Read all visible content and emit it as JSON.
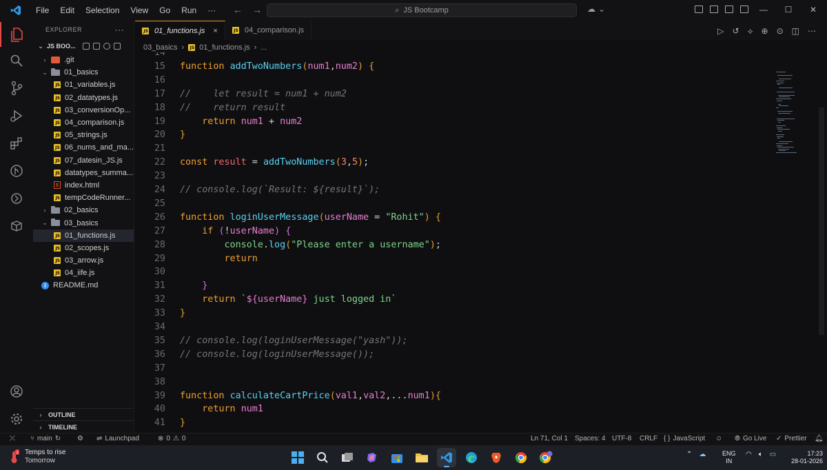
{
  "titlebar": {
    "menu": [
      "File",
      "Edit",
      "Selection",
      "View",
      "Go",
      "Run",
      "···"
    ],
    "search_text": "JS Bootcamp"
  },
  "explorer": {
    "title": "EXPLORER",
    "more": "···",
    "root": "JS BOO...",
    "tree": [
      {
        "type": "folder",
        "label": ".git",
        "depth": 1,
        "icon": "git-icon",
        "open": false
      },
      {
        "type": "folder",
        "label": "01_basics",
        "depth": 1,
        "open": true
      },
      {
        "type": "js",
        "label": "01_variables.js",
        "depth": 2
      },
      {
        "type": "js",
        "label": "02_datatypes.js",
        "depth": 2
      },
      {
        "type": "js",
        "label": "03_conversionOp...",
        "depth": 2
      },
      {
        "type": "js",
        "label": "04_comparison.js",
        "depth": 2
      },
      {
        "type": "js",
        "label": "05_strings.js",
        "depth": 2
      },
      {
        "type": "js",
        "label": "06_nums_and_ma...",
        "depth": 2
      },
      {
        "type": "js",
        "label": "07_datesin_JS.js",
        "depth": 2
      },
      {
        "type": "js",
        "label": "datatypes_summa...",
        "depth": 2
      },
      {
        "type": "html",
        "label": "index.html",
        "depth": 2
      },
      {
        "type": "js",
        "label": "tempCodeRunner...",
        "depth": 2
      },
      {
        "type": "folder",
        "label": "02_basics",
        "depth": 1,
        "open": false
      },
      {
        "type": "folder",
        "label": "03_basics",
        "depth": 1,
        "open": true
      },
      {
        "type": "js",
        "label": "01_functions.js",
        "depth": 2,
        "selected": true
      },
      {
        "type": "js",
        "label": "02_scopes.js",
        "depth": 2
      },
      {
        "type": "js",
        "label": "03_arrow.js",
        "depth": 2
      },
      {
        "type": "js",
        "label": "04_iife.js",
        "depth": 2
      },
      {
        "type": "info",
        "label": "README.md",
        "depth": 1
      }
    ],
    "outline": "OUTLINE",
    "timeline": "TIMELINE"
  },
  "tabs": [
    {
      "label": "01_functions.js",
      "close": "×",
      "active": true
    },
    {
      "label": "04_comparison.js",
      "active": false
    }
  ],
  "breadcrumb": {
    "folder": "03_basics",
    "file": "01_functions.js",
    "more": "..."
  },
  "code": [
    {
      "n": "14",
      "t": []
    },
    {
      "n": "15",
      "t": [
        [
          "kw",
          "function "
        ],
        [
          "fn",
          "addTwoNumbers"
        ],
        [
          "br",
          "("
        ],
        [
          "pm",
          "num1"
        ],
        [
          "",
          ","
        ],
        [
          "pm",
          "num2"
        ],
        [
          "br",
          ")"
        ],
        [
          "",
          " "
        ],
        [
          "br",
          "{"
        ]
      ]
    },
    {
      "n": "16",
      "t": []
    },
    {
      "n": "17",
      "t": [
        [
          "cm",
          "//    let result = num1 + num2"
        ]
      ]
    },
    {
      "n": "18",
      "t": [
        [
          "cm",
          "//    return result"
        ]
      ]
    },
    {
      "n": "19",
      "t": [
        [
          "",
          "    "
        ],
        [
          "kw",
          "return "
        ],
        [
          "pm",
          "num1"
        ],
        [
          "",
          " + "
        ],
        [
          "pm",
          "num2"
        ]
      ]
    },
    {
      "n": "20",
      "t": [
        [
          "br",
          "}"
        ]
      ]
    },
    {
      "n": "21",
      "t": []
    },
    {
      "n": "22",
      "t": [
        [
          "kw",
          "const "
        ],
        [
          "var",
          "result"
        ],
        [
          "",
          " = "
        ],
        [
          "fn",
          "addTwoNumbers"
        ],
        [
          "br",
          "("
        ],
        [
          "num",
          "3"
        ],
        [
          "",
          ","
        ],
        [
          "num",
          "5"
        ],
        [
          "br",
          ")"
        ],
        [
          "",
          ";"
        ]
      ]
    },
    {
      "n": "23",
      "t": []
    },
    {
      "n": "24",
      "t": [
        [
          "cm",
          "// console.log(`Result: ${result}`);"
        ]
      ]
    },
    {
      "n": "25",
      "t": []
    },
    {
      "n": "26",
      "t": [
        [
          "kw",
          "function "
        ],
        [
          "fn",
          "loginUserMessage"
        ],
        [
          "br",
          "("
        ],
        [
          "pm",
          "userName"
        ],
        [
          "",
          " = "
        ],
        [
          "str",
          "\"Rohit\""
        ],
        [
          "br",
          ")"
        ],
        [
          "",
          " "
        ],
        [
          "br",
          "{"
        ]
      ]
    },
    {
      "n": "27",
      "t": [
        [
          "",
          "    "
        ],
        [
          "kw",
          "if "
        ],
        [
          "br2",
          "("
        ],
        [
          "",
          "!"
        ],
        [
          "pm",
          "userName"
        ],
        [
          "br2",
          ")"
        ],
        [
          "",
          " "
        ],
        [
          "br2",
          "{"
        ]
      ]
    },
    {
      "n": "28",
      "t": [
        [
          "",
          "        "
        ],
        [
          "str",
          "console"
        ],
        [
          "",
          "."
        ],
        [
          "fn",
          "log"
        ],
        [
          "br",
          "("
        ],
        [
          "str",
          "\"Please enter a username\""
        ],
        [
          "br",
          ")"
        ],
        [
          "",
          ";"
        ]
      ]
    },
    {
      "n": "29",
      "t": [
        [
          "",
          "        "
        ],
        [
          "kw",
          "return"
        ]
      ]
    },
    {
      "n": "30",
      "t": []
    },
    {
      "n": "31",
      "t": [
        [
          "",
          "    "
        ],
        [
          "br2",
          "}"
        ]
      ]
    },
    {
      "n": "32",
      "t": [
        [
          "",
          "    "
        ],
        [
          "kw",
          "return "
        ],
        [
          "str",
          "`"
        ],
        [
          "pm",
          "${"
        ],
        [
          "pm",
          "userName"
        ],
        [
          "pm",
          "}"
        ],
        [
          "str",
          " just logged in`"
        ]
      ]
    },
    {
      "n": "33",
      "t": [
        [
          "br",
          "}"
        ]
      ]
    },
    {
      "n": "34",
      "t": []
    },
    {
      "n": "35",
      "t": [
        [
          "cm",
          "// console.log(loginUserMessage(\"yash\"));"
        ]
      ]
    },
    {
      "n": "36",
      "t": [
        [
          "cm",
          "// console.log(loginUserMessage());"
        ]
      ]
    },
    {
      "n": "37",
      "t": []
    },
    {
      "n": "38",
      "t": []
    },
    {
      "n": "39",
      "t": [
        [
          "kw",
          "function "
        ],
        [
          "fn",
          "calculateCartPrice"
        ],
        [
          "br",
          "("
        ],
        [
          "pm",
          "val1"
        ],
        [
          "",
          ","
        ],
        [
          "pm",
          "val2"
        ],
        [
          "",
          ","
        ],
        [
          "",
          "..."
        ],
        [
          "pm",
          "num1"
        ],
        [
          "br",
          ")"
        ],
        [
          "br",
          "{"
        ]
      ]
    },
    {
      "n": "40",
      "t": [
        [
          "",
          "    "
        ],
        [
          "kw",
          "return "
        ],
        [
          "pm",
          "num1"
        ]
      ]
    },
    {
      "n": "41",
      "t": [
        [
          "br",
          "}"
        ]
      ]
    }
  ],
  "status": {
    "branch": "main",
    "launchpad": "Launchpad",
    "errors": "0",
    "warnings": "0",
    "position": "Ln 71, Col 1",
    "spaces": "Spaces: 4",
    "encoding": "UTF-8",
    "eol": "CRLF",
    "language": "JavaScript",
    "braces": "{ }",
    "golive": "Go Live",
    "prettier": "Prettier"
  },
  "taskbar": {
    "weather_title": "Temps to rise",
    "weather_sub": "Tomorrow",
    "weather_badge": "3",
    "lang_line1": "ENG",
    "lang_line2": "IN",
    "time": "17:23",
    "date": "28-01-2026"
  },
  "colors": {
    "accent": "#e24a4a",
    "keyword": "#f0a030",
    "function": "#5ad1f0",
    "param": "#e87fd0",
    "string": "#7dd68a"
  }
}
